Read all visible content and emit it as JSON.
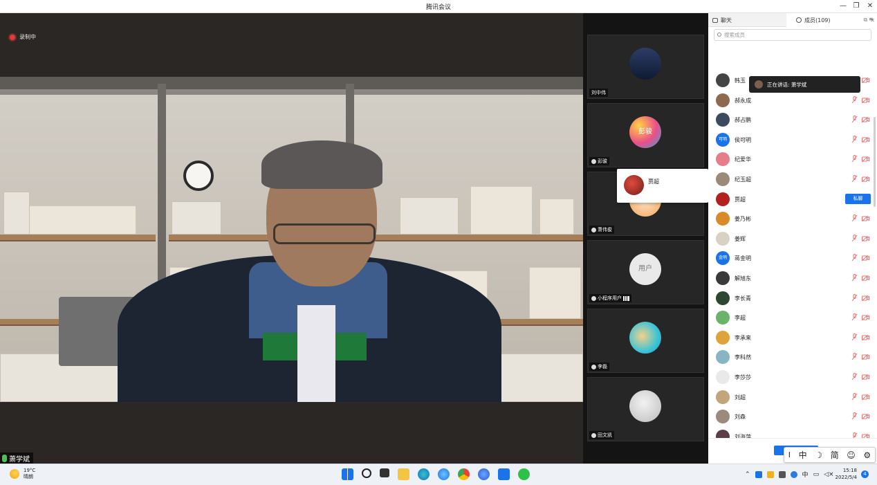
{
  "window": {
    "title": "腾讯会议"
  },
  "stage": {
    "recording_label": "录制中",
    "speaker_name": "萧学斌"
  },
  "thumbnails": [
    {
      "name": "刘中伟"
    },
    {
      "name": "彭骏",
      "avatar_text": "彭骏"
    },
    {
      "name": "萧伟俊"
    },
    {
      "name": "小程序用户",
      "avatar_text": "用户"
    },
    {
      "name": "李磊"
    },
    {
      "name": "田文凯"
    }
  ],
  "popup": {
    "name": "贾超"
  },
  "panel": {
    "tab_chat": "聊天",
    "tab_members": "成员(109)",
    "search_placeholder": "搜索成员",
    "speaking_label": "正在讲话: 萧学斌",
    "private_chat_label": "私聊",
    "members": [
      {
        "name": "韩玉"
      },
      {
        "name": "郝永成"
      },
      {
        "name": "郝占鹏"
      },
      {
        "name": "侯可明",
        "avatar_text": "可明"
      },
      {
        "name": "纪爱华"
      },
      {
        "name": "纪玉超"
      },
      {
        "name": "贾超",
        "hover": true
      },
      {
        "name": "姜乃彬"
      },
      {
        "name": "姜辉"
      },
      {
        "name": "蒋金明",
        "avatar_text": "金明"
      },
      {
        "name": "解旭东"
      },
      {
        "name": "李长青"
      },
      {
        "name": "李超"
      },
      {
        "name": "李承来"
      },
      {
        "name": "李科然"
      },
      {
        "name": "李莎莎"
      },
      {
        "name": "刘超"
      },
      {
        "name": "刘森"
      },
      {
        "name": "刘海萍"
      }
    ]
  },
  "ime": {
    "mode": "中",
    "width": "简"
  },
  "taskbar": {
    "temperature": "19°C",
    "weather": "晴朗",
    "tray_lang": "中",
    "time": "15:18",
    "date": "2022/5/4",
    "notifications": "4"
  }
}
